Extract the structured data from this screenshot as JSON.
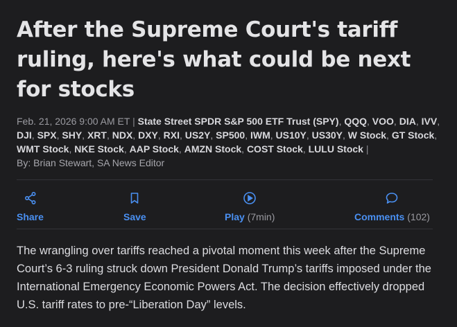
{
  "article": {
    "title": "After the Supreme Court's tariff ruling, here's what could be next for stocks",
    "date": "Feb. 21, 2026 9:00 AM ET",
    "separator": "|",
    "tickers": [
      "State Street SPDR S&P 500 ETF Trust (SPY)",
      "QQQ",
      "VOO",
      "DIA",
      "IVV",
      "DJI",
      "SPX",
      "SHY",
      "XRT",
      "NDX",
      "DXY",
      "RXI",
      "US2Y",
      "SP500",
      "IWM",
      "US10Y",
      "US30Y",
      "W Stock",
      "GT Stock",
      "WMT Stock",
      "NKE Stock",
      "AAP Stock",
      "AMZN Stock",
      "COST Stock",
      "LULU Stock"
    ],
    "byline_prefix": "By:",
    "author": "Brian Stewart",
    "author_role": "SA News Editor",
    "body": "The wrangling over tariffs reached a pivotal moment this week after the Supreme Court’s 6-3 ruling struck down President Donald Trump’s tariffs imposed under the International Emergency Economic Powers Act. The decision effectively dropped U.S. tariff rates to pre-“Liberation Day” levels."
  },
  "actions": {
    "share_label": "Share",
    "save_label": "Save",
    "play_label": "Play",
    "play_duration": "(7min)",
    "comments_label": "Comments",
    "comments_count": "(102)",
    "accent_color": "#4a90f2"
  }
}
